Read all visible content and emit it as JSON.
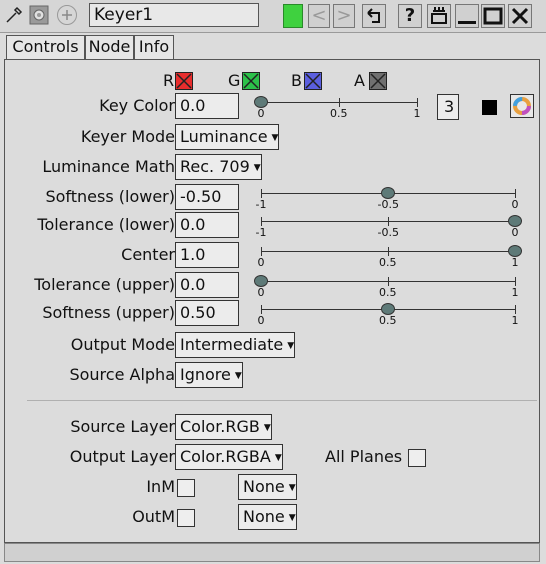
{
  "window": {
    "title": "Keyer1",
    "help_label": "?",
    "colors": {
      "active_green": "#3fd13f",
      "knob": "#5e7a78"
    }
  },
  "tabs": [
    {
      "label": "Controls"
    },
    {
      "label": "Node"
    },
    {
      "label": "Info"
    }
  ],
  "channels": {
    "r_label": "R",
    "g_label": "G",
    "b_label": "B",
    "a_label": "A",
    "r_color": "#e82d2d",
    "g_color": "#2cc14a",
    "b_color": "#5b5fe0",
    "a_color": "#707070"
  },
  "key_color": {
    "label": "Key Color",
    "value": "0.0",
    "ticks": [
      "0",
      "0.5",
      "1"
    ],
    "slider_fraction": 0.0,
    "dimension_count": "3"
  },
  "keyer_mode": {
    "label": "Keyer Mode",
    "value": "Luminance"
  },
  "luminance_math": {
    "label": "Luminance Math",
    "value": "Rec. 709"
  },
  "softness_lower": {
    "label": "Softness (lower)",
    "value": "-0.50",
    "ticks": [
      "-1",
      "-0.5",
      "0"
    ],
    "slider_fraction": 0.5
  },
  "tolerance_lower": {
    "label": "Tolerance (lower)",
    "value": "0.0",
    "ticks": [
      "-1",
      "-0.5",
      "0"
    ],
    "slider_fraction": 1.0
  },
  "center": {
    "label": "Center",
    "value": "1.0",
    "ticks": [
      "0",
      "0.5",
      "1"
    ],
    "slider_fraction": 1.0
  },
  "tolerance_upper": {
    "label": "Tolerance (upper)",
    "value": "0.0",
    "ticks": [
      "0",
      "0.5",
      "1"
    ],
    "slider_fraction": 0.0
  },
  "softness_upper": {
    "label": "Softness (upper)",
    "value": "0.50",
    "ticks": [
      "0",
      "0.5",
      "1"
    ],
    "slider_fraction": 0.5
  },
  "output_mode": {
    "label": "Output Mode",
    "value": "Intermediate"
  },
  "source_alpha": {
    "label": "Source Alpha",
    "value": "Ignore"
  },
  "source_layer": {
    "label": "Source Layer",
    "value": "Color.RGB"
  },
  "output_layer": {
    "label": "Output Layer",
    "value": "Color.RGBA"
  },
  "all_planes": {
    "label": "All Planes",
    "checked": false
  },
  "inm": {
    "label": "InM",
    "value": "None",
    "checked": false
  },
  "outm": {
    "label": "OutM",
    "value": "None",
    "checked": false
  }
}
